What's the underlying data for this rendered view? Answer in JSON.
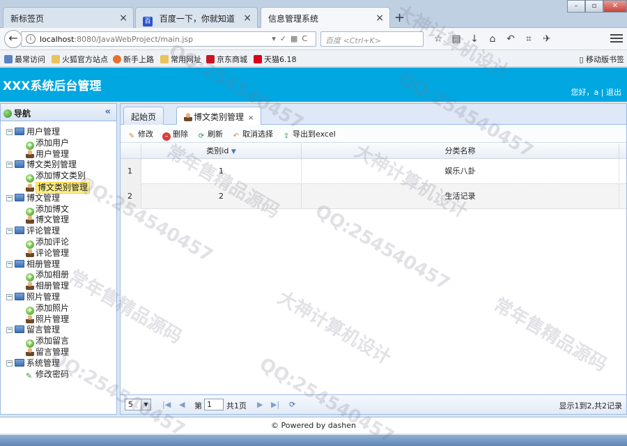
{
  "browser": {
    "tabs": [
      {
        "label": "新标签页"
      },
      {
        "label": "百度一下，你就知道"
      },
      {
        "label": "信息管理系统"
      }
    ],
    "url_host": "localhost",
    "url_rest": ":8080/JavaWebProject/main.jsp",
    "search_placeholder": "百度 <Ctrl+K>",
    "bookmarks": [
      {
        "label": "最常访问"
      },
      {
        "label": "火狐官方站点"
      },
      {
        "label": "新手上路"
      },
      {
        "label": "常用网址"
      },
      {
        "label": "京东商城"
      },
      {
        "label": "天猫6.18"
      }
    ],
    "mobile_bookmarks": "移动版书签"
  },
  "header": {
    "title": "XXX系统后台管理",
    "greeting": "您好，a",
    "separator": "|",
    "logout": "退出"
  },
  "sidebar": {
    "title": "导航",
    "groups": [
      {
        "label": "用户管理",
        "items": [
          "添加用户",
          "用户管理"
        ]
      },
      {
        "label": "博文类别管理",
        "items": [
          "添加博文类别",
          "博文类别管理"
        ]
      },
      {
        "label": "博文管理",
        "items": [
          "添加博文",
          "博文管理"
        ]
      },
      {
        "label": "评论管理",
        "items": [
          "添加评论",
          "评论管理"
        ]
      },
      {
        "label": "相册管理",
        "items": [
          "添加相册",
          "相册管理"
        ]
      },
      {
        "label": "照片管理",
        "items": [
          "添加照片",
          "照片管理"
        ]
      },
      {
        "label": "留言管理",
        "items": [
          "添加留言",
          "留言管理"
        ]
      },
      {
        "label": "系统管理",
        "items": [
          "修改密码"
        ]
      }
    ],
    "selected": "博文类别管理"
  },
  "main": {
    "tabs": [
      {
        "label": "起始页"
      },
      {
        "label": "博文类别管理"
      }
    ],
    "toolbar": {
      "edit": "修改",
      "delete": "删除",
      "refresh": "刷新",
      "cancel": "取消选择",
      "export": "导出到excel"
    },
    "grid": {
      "columns": [
        "类别id",
        "分类名称"
      ],
      "rows": [
        {
          "num": "1",
          "id": "1",
          "name": "娱乐八卦"
        },
        {
          "num": "2",
          "id": "2",
          "name": "生活记录"
        }
      ]
    },
    "pager": {
      "page_size": "5",
      "page_prefix": "第",
      "page_value": "1",
      "page_suffix": "共1页",
      "info": "显示1到2,共2记录"
    }
  },
  "footer": {
    "text": "© Powered by dashen"
  },
  "watermarks": [
    "大神计算机设计",
    "QQ:254540457",
    "常年售精品源码"
  ]
}
